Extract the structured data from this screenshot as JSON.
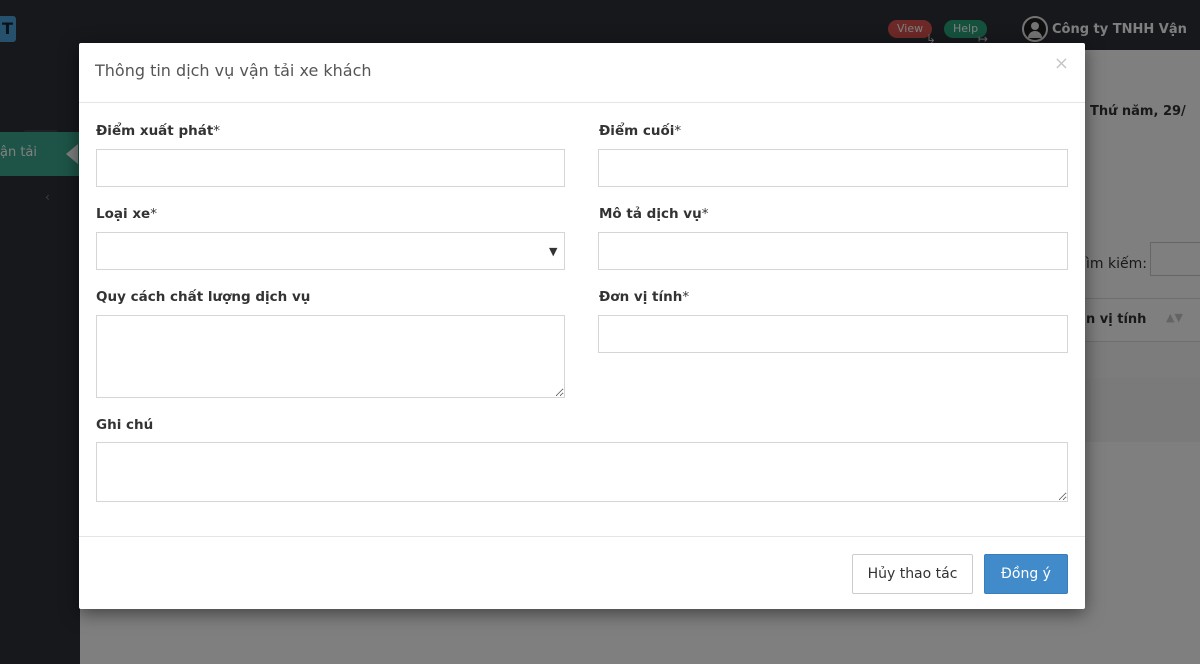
{
  "header": {
    "logo_letter": "T",
    "view_label": "View",
    "help_label": "Help",
    "company_name": "Công ty TNHH Vận"
  },
  "sidebar": {
    "active_item_label": "ận tải",
    "collapse_glyph": "‹"
  },
  "background_page": {
    "date_text": "Thứ năm, 29/",
    "search_label": "ìm kiếm:",
    "column_header": "n vị tính"
  },
  "modal": {
    "title": "Thông tin dịch vụ vận tải xe khách",
    "close_glyph": "×",
    "fields": {
      "start_point": {
        "label": "Điểm xuất phát",
        "required": "*",
        "value": ""
      },
      "end_point": {
        "label": "Điểm cuối",
        "required": "*",
        "value": ""
      },
      "vehicle_type": {
        "label": "Loại xe",
        "required": "*",
        "value": ""
      },
      "service_description": {
        "label": "Mô tả dịch vụ",
        "required": "*",
        "value": ""
      },
      "quality_spec": {
        "label": "Quy cách chất lượng dịch vụ",
        "value": ""
      },
      "unit": {
        "label": "Đơn vị tính",
        "required": "*",
        "value": ""
      },
      "note": {
        "label": "Ghi chú",
        "value": ""
      }
    },
    "buttons": {
      "cancel": "Hủy thao tác",
      "confirm": "Đồng ý"
    }
  },
  "colors": {
    "topbar": "#2d3138",
    "sidebar_active": "#3aa98f",
    "primary_button": "#428bca",
    "view_badge": "#d9534f",
    "help_badge": "#2aa57a"
  }
}
